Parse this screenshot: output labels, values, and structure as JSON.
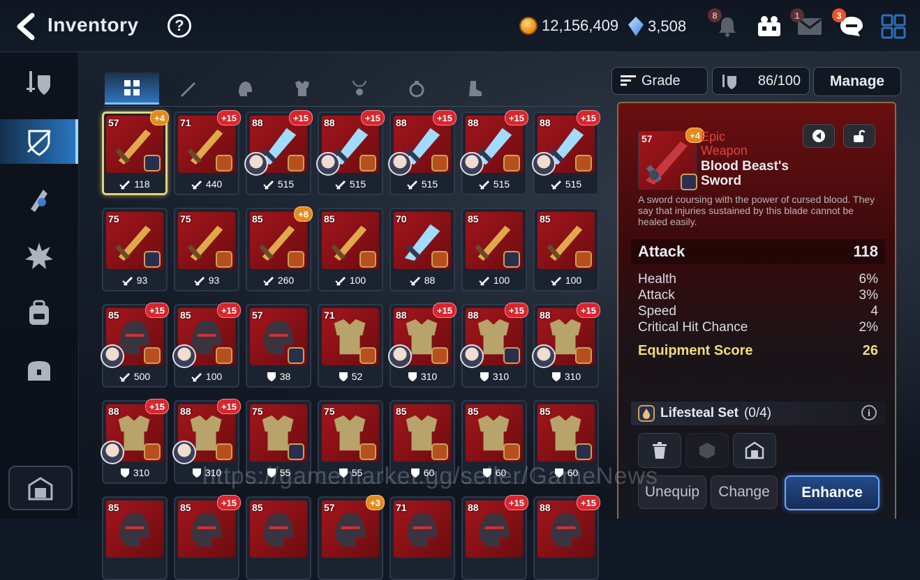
{
  "header": {
    "title": "Inventory",
    "help_label": "?",
    "gold": "12,156,409",
    "crystals": "3,508",
    "notifications_badge": "8",
    "mail_badge": "1",
    "chat_badge": "3"
  },
  "sidebar": {
    "items": [
      {
        "name": "equipment-icon"
      },
      {
        "name": "gear-selected-icon"
      },
      {
        "name": "artifact-icon"
      },
      {
        "name": "material-icon"
      },
      {
        "name": "bag-icon"
      },
      {
        "name": "chest-icon"
      }
    ],
    "storage": "storage-icon"
  },
  "tabs": [
    {
      "name": "all-icon"
    },
    {
      "name": "weapon-icon"
    },
    {
      "name": "helmet-icon"
    },
    {
      "name": "armor-icon"
    },
    {
      "name": "necklace-icon"
    },
    {
      "name": "ring-icon"
    },
    {
      "name": "boots-icon"
    }
  ],
  "controls": {
    "sort_label": "Grade",
    "capacity": "86/100",
    "manage_label": "Manage"
  },
  "grid": {
    "rows": [
      [
        {
          "level": "57",
          "plus": "+4",
          "plus_color": "orange",
          "stat": "118",
          "stat_type": "atk",
          "set": "blue",
          "portrait": false,
          "selected": true,
          "kind": "sword"
        },
        {
          "level": "71",
          "plus": "+15",
          "plus_color": "red",
          "stat": "440",
          "stat_type": "atk",
          "set": "gold",
          "portrait": false,
          "kind": "sword"
        },
        {
          "level": "88",
          "plus": "+15",
          "plus_color": "red",
          "stat": "515",
          "stat_type": "atk",
          "set": "gold",
          "portrait": true,
          "kind": "blade"
        },
        {
          "level": "88",
          "plus": "+15",
          "plus_color": "red",
          "stat": "515",
          "stat_type": "atk",
          "set": "gold",
          "portrait": true,
          "kind": "blade"
        },
        {
          "level": "88",
          "plus": "+15",
          "plus_color": "red",
          "stat": "515",
          "stat_type": "atk",
          "set": "gold",
          "portrait": true,
          "kind": "blade"
        },
        {
          "level": "88",
          "plus": "+15",
          "plus_color": "red",
          "stat": "515",
          "stat_type": "atk",
          "set": "gold",
          "portrait": true,
          "kind": "blade"
        },
        {
          "level": "88",
          "plus": "+15",
          "plus_color": "red",
          "stat": "515",
          "stat_type": "atk",
          "set": "gold",
          "portrait": true,
          "kind": "blade"
        }
      ],
      [
        {
          "level": "75",
          "plus": "",
          "stat": "93",
          "stat_type": "atk",
          "set": "blue",
          "portrait": false,
          "kind": "sword"
        },
        {
          "level": "75",
          "plus": "",
          "stat": "93",
          "stat_type": "atk",
          "set": "gold",
          "portrait": false,
          "kind": "sword"
        },
        {
          "level": "85",
          "plus": "+8",
          "plus_color": "orange",
          "stat": "260",
          "stat_type": "atk",
          "set": "gold",
          "portrait": false,
          "kind": "sword"
        },
        {
          "level": "85",
          "plus": "",
          "stat": "100",
          "stat_type": "atk",
          "set": "gold",
          "portrait": false,
          "kind": "sword"
        },
        {
          "level": "70",
          "plus": "",
          "stat": "88",
          "stat_type": "atk",
          "set": "gold",
          "portrait": false,
          "kind": "blade"
        },
        {
          "level": "85",
          "plus": "",
          "stat": "100",
          "stat_type": "atk",
          "set": "blue",
          "portrait": false,
          "kind": "sword"
        },
        {
          "level": "85",
          "plus": "",
          "stat": "100",
          "stat_type": "atk",
          "set": "gold",
          "portrait": false,
          "kind": "sword"
        }
      ],
      [
        {
          "level": "85",
          "plus": "+15",
          "plus_color": "red",
          "stat": "500",
          "stat_type": "atk",
          "set": "gold",
          "portrait": true,
          "kind": "helm"
        },
        {
          "level": "85",
          "plus": "+15",
          "plus_color": "red",
          "stat": "100",
          "stat_type": "atk",
          "set": "gold",
          "portrait": true,
          "kind": "helm"
        },
        {
          "level": "57",
          "plus": "",
          "stat": "38",
          "stat_type": "def",
          "set": "blue",
          "portrait": false,
          "kind": "helm"
        },
        {
          "level": "71",
          "plus": "",
          "stat": "52",
          "stat_type": "def",
          "set": "gold",
          "portrait": false,
          "kind": "armor"
        },
        {
          "level": "88",
          "plus": "+15",
          "plus_color": "red",
          "stat": "310",
          "stat_type": "def",
          "set": "gold",
          "portrait": true,
          "kind": "armor"
        },
        {
          "level": "88",
          "plus": "+15",
          "plus_color": "red",
          "stat": "310",
          "stat_type": "def",
          "set": "blue",
          "portrait": true,
          "kind": "armor"
        },
        {
          "level": "88",
          "plus": "+15",
          "plus_color": "red",
          "stat": "310",
          "stat_type": "def",
          "set": "gold",
          "portrait": true,
          "kind": "armor"
        }
      ],
      [
        {
          "level": "88",
          "plus": "+15",
          "plus_color": "red",
          "stat": "310",
          "stat_type": "def",
          "set": "gold",
          "portrait": true,
          "kind": "armor"
        },
        {
          "level": "88",
          "plus": "+15",
          "plus_color": "red",
          "stat": "310",
          "stat_type": "def",
          "set": "gold",
          "portrait": true,
          "kind": "armor"
        },
        {
          "level": "75",
          "plus": "",
          "stat": "55",
          "stat_type": "def",
          "set": "blue",
          "portrait": false,
          "kind": "armor"
        },
        {
          "level": "75",
          "plus": "",
          "stat": "55",
          "stat_type": "def",
          "set": "gold",
          "portrait": false,
          "kind": "armor"
        },
        {
          "level": "85",
          "plus": "",
          "stat": "60",
          "stat_type": "def",
          "set": "gold",
          "portrait": false,
          "kind": "armor"
        },
        {
          "level": "85",
          "plus": "",
          "stat": "60",
          "stat_type": "def",
          "set": "gold",
          "portrait": false,
          "kind": "armor"
        },
        {
          "level": "85",
          "plus": "",
          "stat": "60",
          "stat_type": "def",
          "set": "blue",
          "portrait": false,
          "kind": "armor"
        }
      ],
      [
        {
          "level": "85",
          "plus": "",
          "stat": "",
          "set": "",
          "portrait": false,
          "kind": "helm"
        },
        {
          "level": "85",
          "plus": "+15",
          "plus_color": "red",
          "stat": "",
          "set": "",
          "portrait": false,
          "kind": "helm"
        },
        {
          "level": "85",
          "plus": "",
          "stat": "",
          "set": "",
          "portrait": false,
          "kind": "helm"
        },
        {
          "level": "57",
          "plus": "+3",
          "plus_color": "orange",
          "stat": "",
          "set": "",
          "portrait": false,
          "kind": "helm"
        },
        {
          "level": "71",
          "plus": "",
          "stat": "",
          "set": "",
          "portrait": false,
          "kind": "helm"
        },
        {
          "level": "88",
          "plus": "+15",
          "plus_color": "red",
          "stat": "",
          "set": "",
          "portrait": false,
          "kind": "helm"
        },
        {
          "level": "88",
          "plus": "+15",
          "plus_color": "red",
          "stat": "",
          "set": "",
          "portrait": false,
          "kind": "helm"
        }
      ]
    ]
  },
  "detail": {
    "level": "57",
    "plus": "+4",
    "grade": "Epic",
    "type": "Weapon",
    "name": "Blood Beast's Sword",
    "description": "A sword coursing with the power of cursed blood. They say that injuries sustained by this blade cannot be healed easily.",
    "main_stat": {
      "label": "Attack",
      "value": "118"
    },
    "sub_stats": [
      {
        "label": "Health",
        "value": "6%"
      },
      {
        "label": "Attack",
        "value": "3%"
      },
      {
        "label": "Speed",
        "value": "4"
      },
      {
        "label": "Critical Hit Chance",
        "value": "2%"
      }
    ],
    "score": {
      "label": "Equipment Score",
      "value": "26"
    },
    "set": {
      "label": "Lifesteal Set",
      "progress": "(0/4)"
    },
    "buttons": {
      "unequip": "Unequip",
      "change": "Change",
      "enhance": "Enhance"
    }
  },
  "watermark": "https://gamemarket.gg/seller/GameNews",
  "colors": {
    "accent": "#2a78c4",
    "epic": "#e2433a",
    "score": "#f1dc7c"
  }
}
